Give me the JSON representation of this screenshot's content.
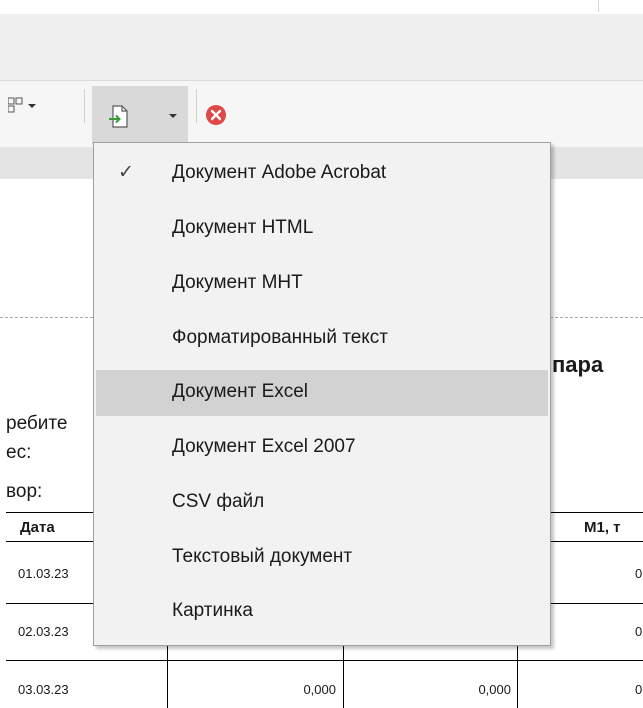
{
  "toolbar": {
    "layout_icon": "layout-grid-icon",
    "export_icon": "export-document-icon",
    "cancel_icon": "red-close-circle-icon",
    "export_active_bg": "#d9d9d9"
  },
  "menu": {
    "items": [
      {
        "label": "Документ Adobe Acrobat",
        "checked": true
      },
      {
        "label": "Документ HTML"
      },
      {
        "label": "Документ MHT"
      },
      {
        "label": "Форматированный текст"
      },
      {
        "label": "Документ Excel",
        "highlighted": true
      },
      {
        "label": "Документ Excel 2007"
      },
      {
        "label": "CSV файл"
      },
      {
        "label": "Текстовый документ"
      },
      {
        "label": "Картинка"
      }
    ],
    "check_mark": "✓",
    "highlight_color": "#d2d2d2"
  },
  "report": {
    "title": "пара",
    "consumer_label": "ребите",
    "address_label": "ес:",
    "contract_label": "вор:",
    "columns": {
      "date": "Дата",
      "m1": "М1, т"
    },
    "rows": [
      {
        "date": "01.03.23",
        "m1": "0"
      },
      {
        "date": "02.03.23",
        "m1": "0"
      },
      {
        "date": "03.03.23",
        "v1": "0,000",
        "v2": "0,000",
        "m1": "0"
      }
    ]
  }
}
